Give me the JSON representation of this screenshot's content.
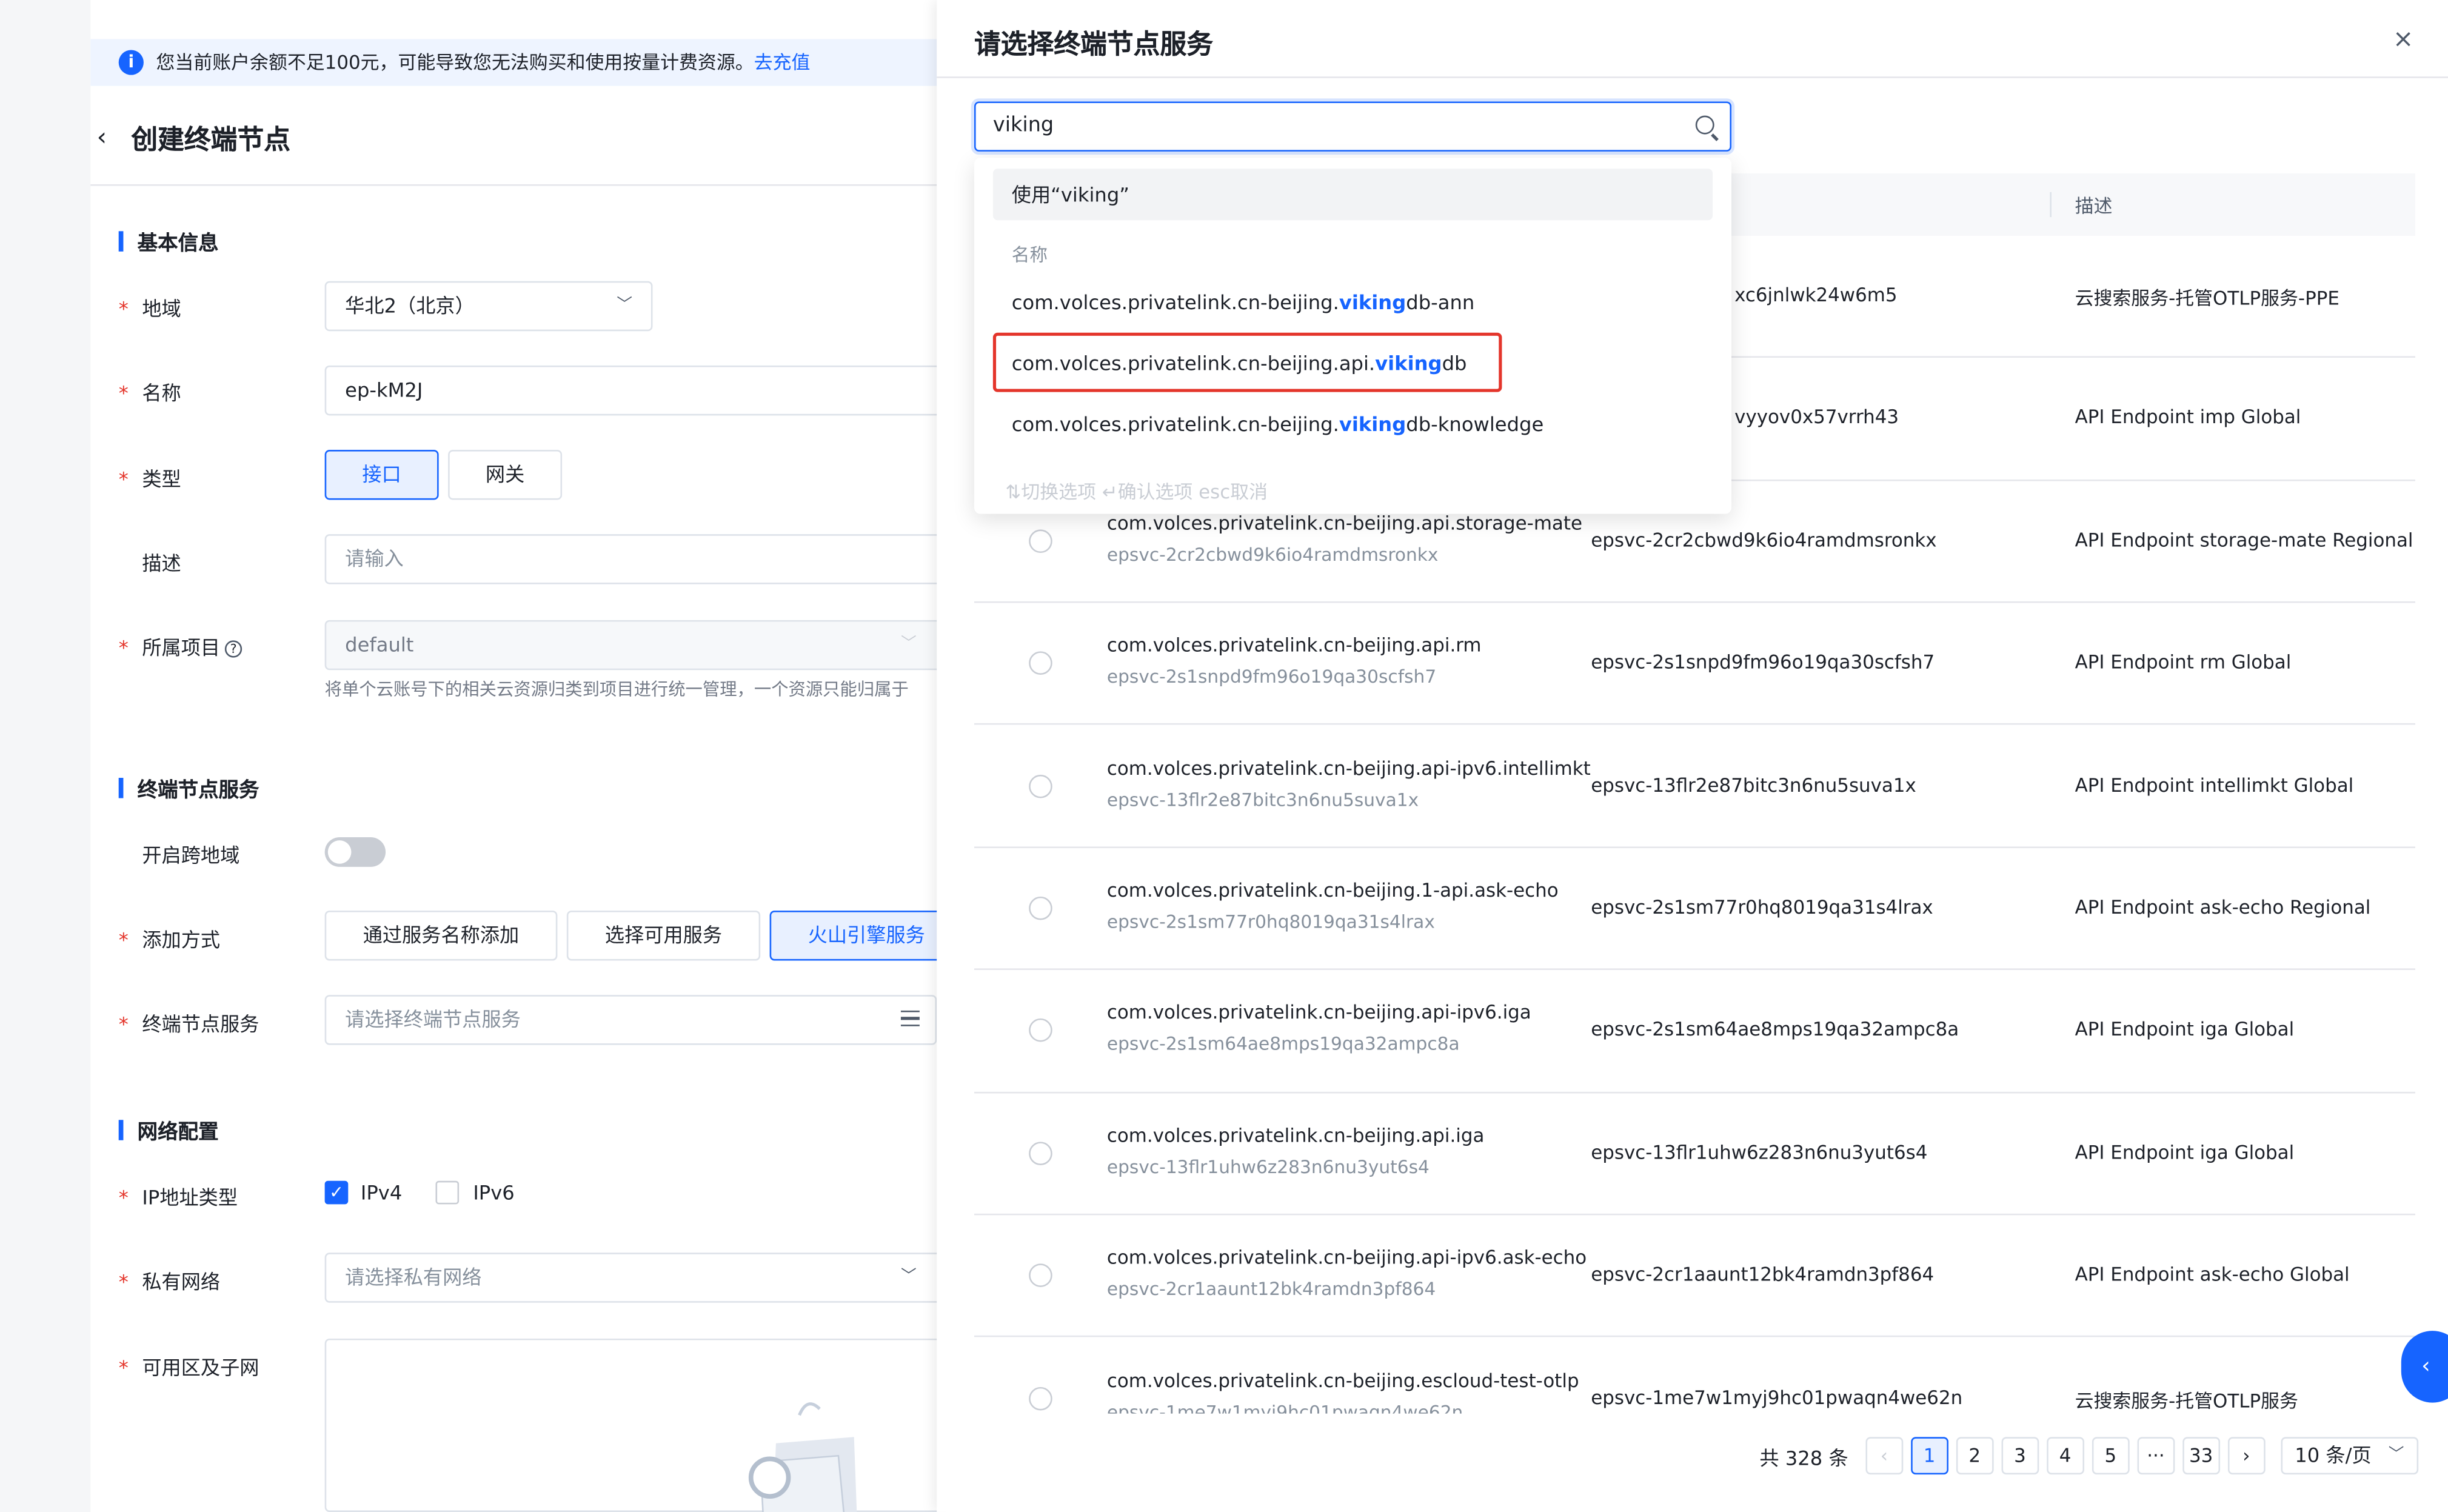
{
  "notice": {
    "text": "您当前账户余额不足100元，可能导致您无法购买和使用按量计费资源。",
    "link": "去充值",
    "icon": "i"
  },
  "page": {
    "title": "创建终端节点"
  },
  "sections": {
    "basic": "基本信息",
    "service": "终端节点服务",
    "network": "网络配置"
  },
  "form": {
    "region_label": "地域",
    "region_value": "华北2（北京）",
    "name_label": "名称",
    "name_value": "ep-kM2J",
    "type_label": "类型",
    "type_interface": "接口",
    "type_gateway": "网关",
    "desc_label": "描述",
    "desc_placeholder": "请输入",
    "project_label": "所属项目",
    "project_value": "default",
    "project_hint": "将单个云账号下的相关云资源归类到项目进行统一管理，一个资源只能归属于",
    "cross_region_label": "开启跨地域",
    "add_method_label": "添加方式",
    "add_by_name": "通过服务名称添加",
    "add_select": "选择可用服务",
    "add_volc": "火山引擎服务",
    "service_label": "终端节点服务",
    "service_placeholder": "请选择终端节点服务",
    "ip_type_label": "IP地址类型",
    "ipv4": "IPv4",
    "ipv6": "IPv6",
    "vpc_label": "私有网络",
    "vpc_placeholder": "请选择私有网络",
    "zone_label": "可用区及子网"
  },
  "drawer": {
    "title": "请选择终端节点服务",
    "close": "×",
    "search_value": "viking",
    "col_desc": "描述"
  },
  "dropdown": {
    "use_label": "使用“viking”",
    "group_label": "名称",
    "items": [
      {
        "prefix": "com.volces.privatelink.cn-beijing.",
        "match": "viking",
        "suffix": "db-ann"
      },
      {
        "prefix": "com.volces.privatelink.cn-beijing.api.",
        "match": "viking",
        "suffix": "db"
      },
      {
        "prefix": "com.volces.privatelink.cn-beijing.",
        "match": "viking",
        "suffix": "db-knowledge"
      }
    ],
    "footer": "⇅切换选项  ↵确认选项  esc取消"
  },
  "rows": [
    {
      "name": "",
      "sub": "",
      "id": "xc6jnlwk24w6m5",
      "desc": "云搜索服务-托管OTLP服务-PPE"
    },
    {
      "name": "",
      "sub": "",
      "id": "vyyov0x57vrrh43",
      "desc": "API Endpoint imp Global"
    },
    {
      "name": "com.volces.privatelink.cn-beijing.api.storage-mate",
      "sub": "epsvc-2cr2cbwd9k6io4ramdmsronkx",
      "id": "epsvc-2cr2cbwd9k6io4ramdmsronkx",
      "desc": "API Endpoint storage-mate Regional"
    },
    {
      "name": "com.volces.privatelink.cn-beijing.api.rm",
      "sub": "epsvc-2s1snpd9fm96o19qa30scfsh7",
      "id": "epsvc-2s1snpd9fm96o19qa30scfsh7",
      "desc": "API Endpoint rm Global"
    },
    {
      "name": "com.volces.privatelink.cn-beijing.api-ipv6.intellimkt",
      "sub": "epsvc-13flr2e87bitc3n6nu5suva1x",
      "id": "epsvc-13flr2e87bitc3n6nu5suva1x",
      "desc": "API Endpoint intellimkt Global"
    },
    {
      "name": "com.volces.privatelink.cn-beijing.1-api.ask-echo",
      "sub": "epsvc-2s1sm77r0hq8019qa31s4lrax",
      "id": "epsvc-2s1sm77r0hq8019qa31s4lrax",
      "desc": "API Endpoint ask-echo Regional"
    },
    {
      "name": "com.volces.privatelink.cn-beijing.api-ipv6.iga",
      "sub": "epsvc-2s1sm64ae8mps19qa32ampc8a",
      "id": "epsvc-2s1sm64ae8mps19qa32ampc8a",
      "desc": "API Endpoint iga Global"
    },
    {
      "name": "com.volces.privatelink.cn-beijing.api.iga",
      "sub": "epsvc-13flr1uhw6z283n6nu3yut6s4",
      "id": "epsvc-13flr1uhw6z283n6nu3yut6s4",
      "desc": "API Endpoint iga Global"
    },
    {
      "name": "com.volces.privatelink.cn-beijing.api-ipv6.ask-echo",
      "sub": "epsvc-2cr1aaunt12bk4ramdn3pf864",
      "id": "epsvc-2cr1aaunt12bk4ramdn3pf864",
      "desc": "API Endpoint ask-echo Global"
    },
    {
      "name": "com.volces.privatelink.cn-beijing.escloud-test-otlp",
      "sub": "epsvc-1me7w1myj9hc01pwaqn4we62n",
      "id": "epsvc-1me7w1myj9hc01pwaqn4we62n",
      "desc": "云搜索服务-托管OTLP服务"
    }
  ],
  "pagination": {
    "total": "共 328 条",
    "prev": "‹",
    "pages": [
      "1",
      "2",
      "3",
      "4",
      "5",
      "···",
      "33"
    ],
    "next": "›",
    "page_size": "10 条/页"
  },
  "side_tab": "‹",
  "colors": {
    "primary": "#1664ff",
    "danger": "#e4352b"
  }
}
